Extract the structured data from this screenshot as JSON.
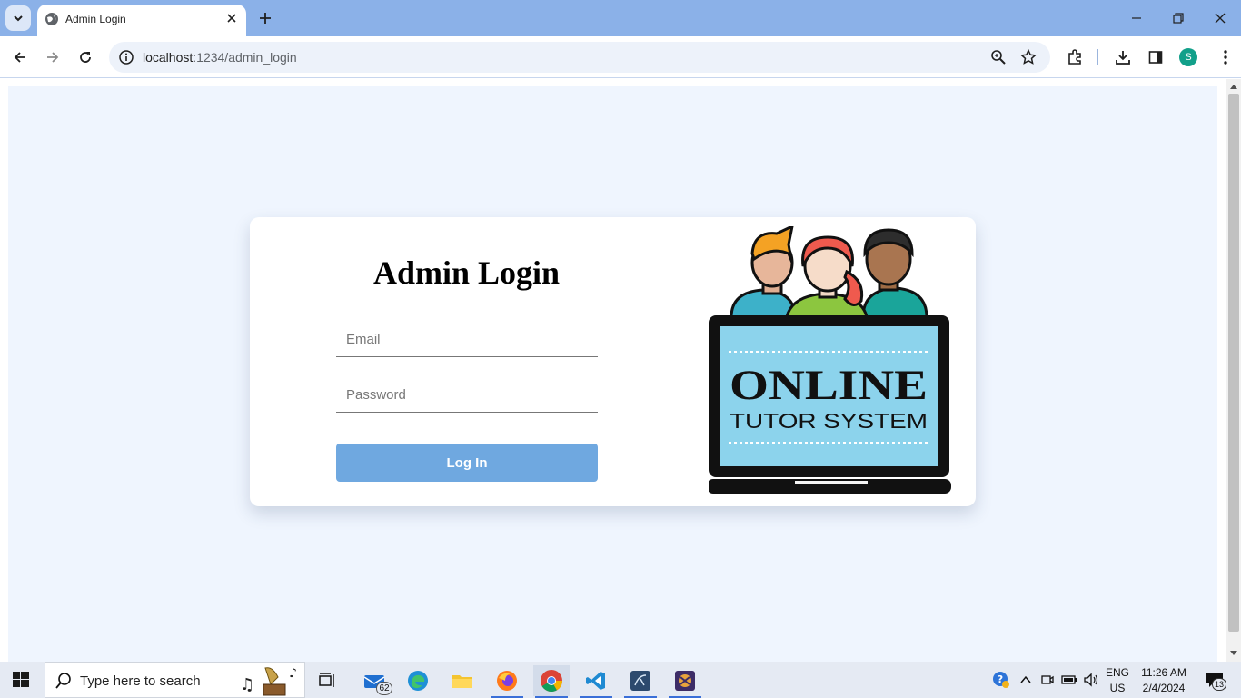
{
  "browser": {
    "tab_title": "Admin Login",
    "url_host": "localhost",
    "url_path": ":1234/admin_login",
    "profile_initial": "S"
  },
  "login": {
    "title": "Admin Login",
    "email_placeholder": "Email",
    "password_placeholder": "Password",
    "submit_label": "Log In"
  },
  "illustration": {
    "line1": "ONLINE",
    "line2": "TUTOR SYSTEM"
  },
  "taskbar": {
    "search_placeholder": "Type here to search",
    "mail_badge": "62",
    "language": "ENG",
    "region": "US",
    "time": "11:26 AM",
    "date": "2/4/2024",
    "notification_count": "13"
  },
  "colors": {
    "tab_strip": "#8bb1e8",
    "page_bg": "#eff5fe",
    "login_button": "#6fa8e0",
    "taskbar": "#e5eaf3"
  }
}
